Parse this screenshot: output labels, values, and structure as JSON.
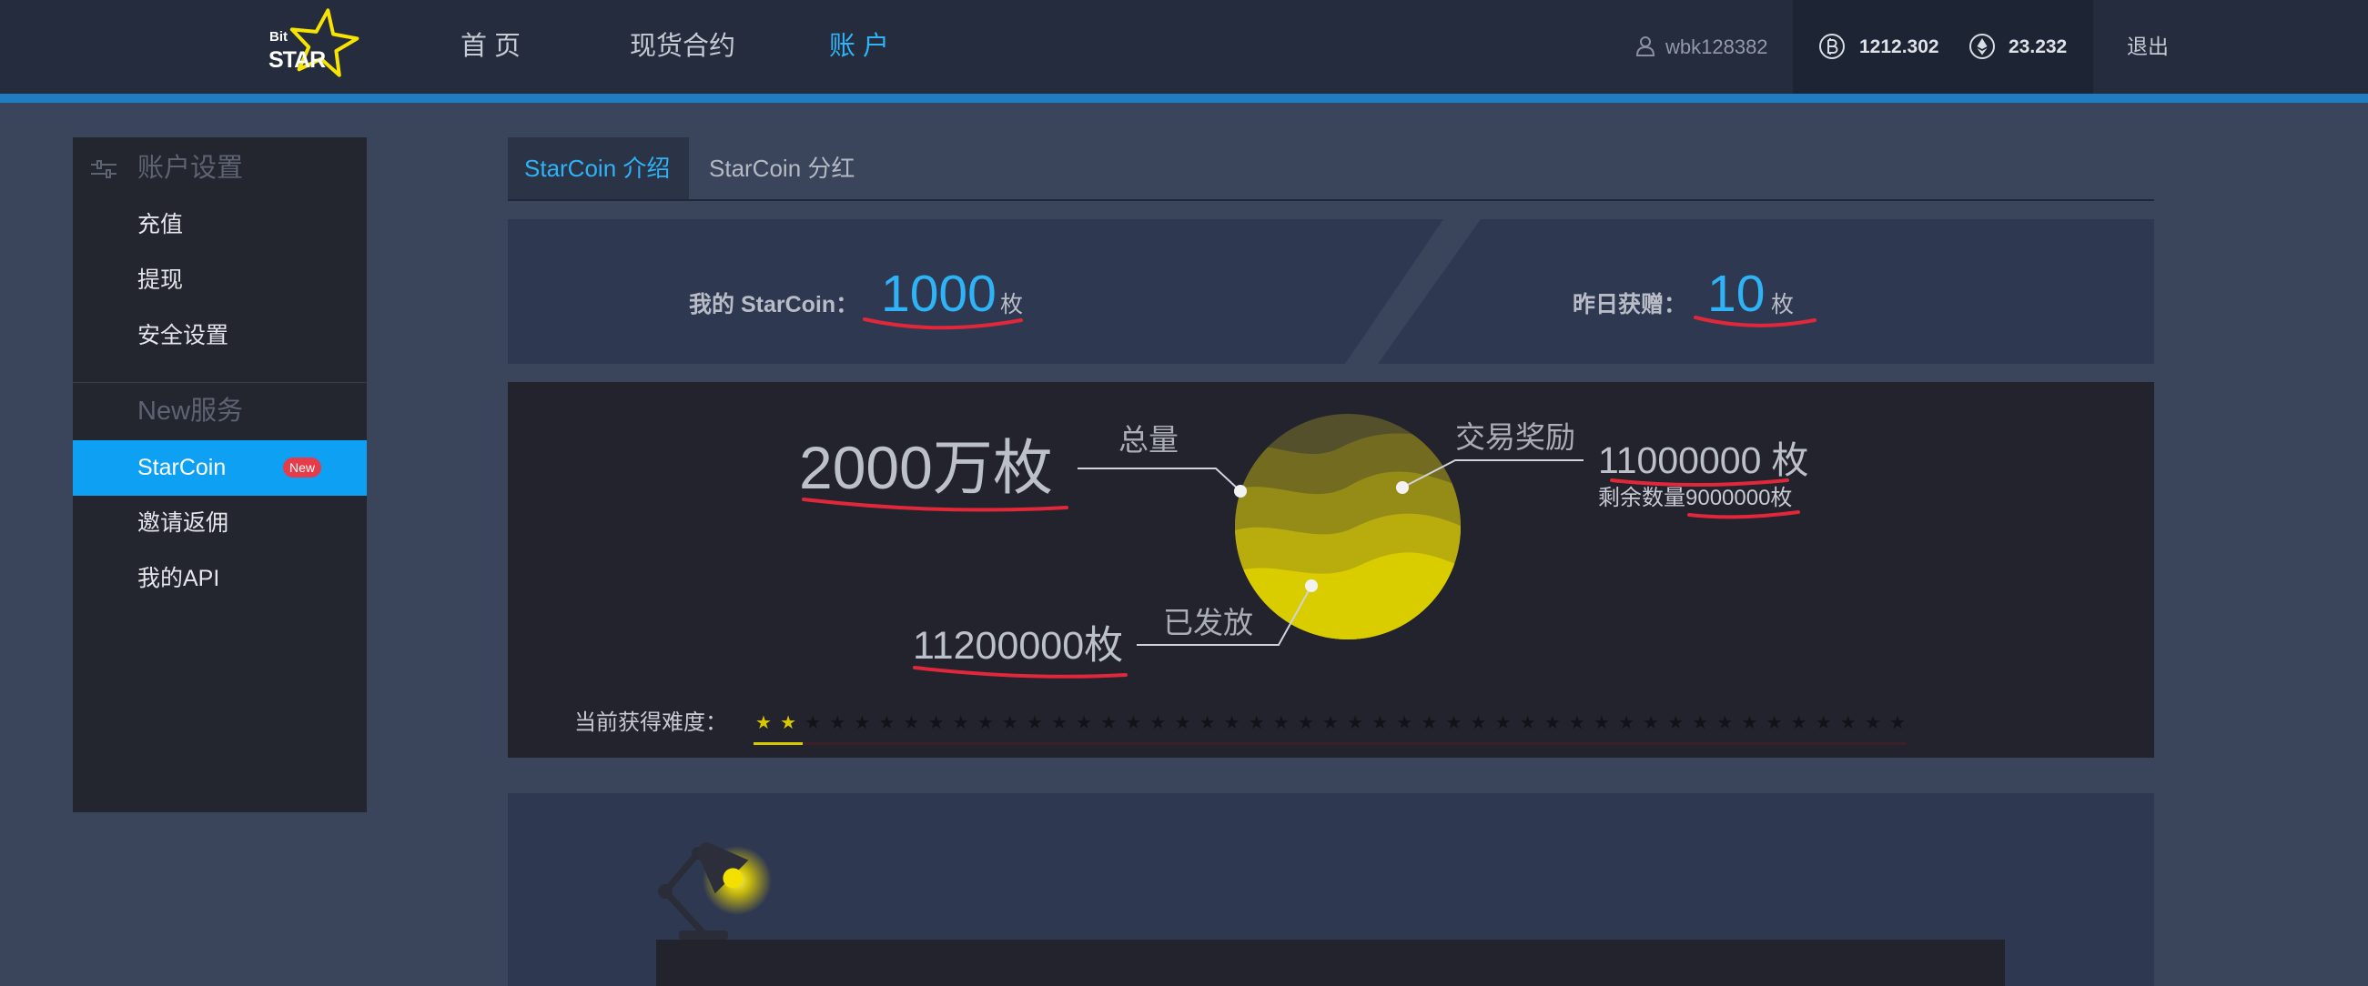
{
  "header": {
    "logo": {
      "top": "Bit",
      "bottom": "STAR",
      "icon": "star-logo-icon"
    },
    "nav": [
      {
        "label": "首 页",
        "active": false
      },
      {
        "label": "现货合约",
        "active": false
      },
      {
        "label": "账 户",
        "active": true
      }
    ],
    "user": {
      "icon": "user-icon",
      "name": "wbk128382"
    },
    "balances": [
      {
        "icon": "bitcoin-icon",
        "value": "1212.302"
      },
      {
        "icon": "ethereum-icon",
        "value": "23.232"
      }
    ],
    "logout": "退出"
  },
  "sidebar": {
    "groups": [
      {
        "title": "账户设置",
        "icon": "sliders-icon",
        "items": [
          {
            "label": "充值"
          },
          {
            "label": "提现"
          },
          {
            "label": "安全设置"
          }
        ]
      },
      {
        "title": "New服务",
        "items": [
          {
            "label": "StarCoin",
            "badge": "New",
            "active": true
          },
          {
            "label": "邀请返佣"
          },
          {
            "label": "我的API"
          }
        ]
      }
    ]
  },
  "tabs": [
    {
      "label": "StarCoin 介绍",
      "active": true
    },
    {
      "label": "StarCoin 分红",
      "active": false
    }
  ],
  "stats": {
    "mine": {
      "label": "我的 StarCoin：",
      "value": "1000",
      "unit": "枚"
    },
    "yesterday": {
      "label": "昨日获赠：",
      "value": "10",
      "unit": "枚"
    }
  },
  "distribution": {
    "total": {
      "label": "总量",
      "value": "2000万枚"
    },
    "reward": {
      "label": "交易奖励",
      "value": "11000000",
      "unit": "枚",
      "remaining_label": "剩余数量",
      "remaining_value": "9000000枚"
    },
    "issued": {
      "label": "已发放",
      "value": "11200000枚"
    }
  },
  "difficulty": {
    "label": "当前获得难度：",
    "level": 2,
    "stars_total": 47
  },
  "illustration": {
    "icon": "desk-lamp-icon"
  },
  "colors": {
    "accent": "#2fb3f7",
    "active_item": "#0ea0f2",
    "header_stripe": "#1f7dc4",
    "badge": "#e63c4a",
    "annotation": "#e0283a",
    "star_filled": "#d8c800",
    "logo_star": "#f7e400"
  }
}
